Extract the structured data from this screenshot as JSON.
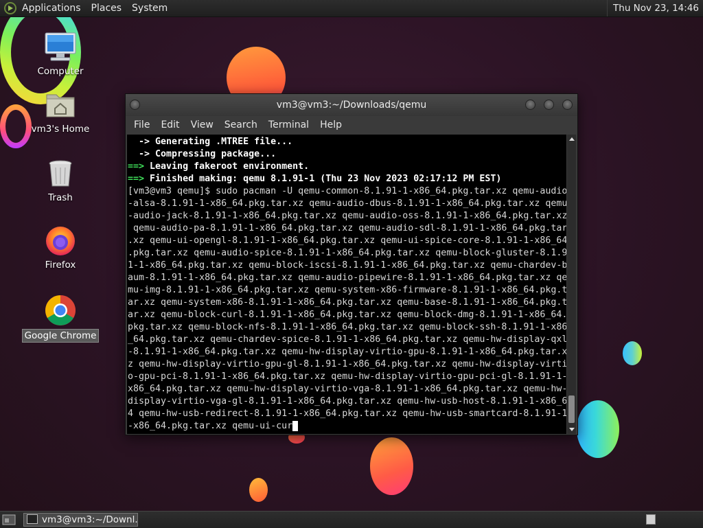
{
  "top_panel": {
    "menus": [
      "Applications",
      "Places",
      "System"
    ],
    "clock": "Thu Nov 23, 14:46"
  },
  "desktop": {
    "icons": [
      {
        "label": "Computer",
        "icon": "computer-icon"
      },
      {
        "label": "vm3's Home",
        "icon": "home-folder-icon"
      },
      {
        "label": "Trash",
        "icon": "trash-icon"
      },
      {
        "label": "Firefox",
        "icon": "firefox-icon"
      },
      {
        "label": "Google Chrome",
        "icon": "chrome-icon"
      }
    ]
  },
  "terminal": {
    "title": "vm3@vm3:~/Downloads/qemu",
    "menu": [
      "File",
      "Edit",
      "View",
      "Search",
      "Terminal",
      "Help"
    ],
    "lines": [
      {
        "prefix": "  -> ",
        "text": "Generating .MTREE file...",
        "style": "bold"
      },
      {
        "prefix": "  -> ",
        "text": "Compressing package...",
        "style": "bold"
      },
      {
        "prefix": "==> ",
        "text": "Leaving fakeroot environment.",
        "style": "bold"
      },
      {
        "prefix": "==> ",
        "text": "Finished making: qemu 8.1.91-1 (Thu 23 Nov 2023 02:17:12 PM EST)",
        "style": "bold"
      }
    ],
    "command_wrapped": [
      "[vm3@vm3 qemu]$ sudo pacman -U qemu-common-8.1.91-1-x86_64.pkg.tar.xz qemu-audio",
      "-alsa-8.1.91-1-x86_64.pkg.tar.xz qemu-audio-dbus-8.1.91-1-x86_64.pkg.tar.xz qemu",
      "-audio-jack-8.1.91-1-x86_64.pkg.tar.xz qemu-audio-oss-8.1.91-1-x86_64.pkg.tar.xz",
      " qemu-audio-pa-8.1.91-1-x86_64.pkg.tar.xz qemu-audio-sdl-8.1.91-1-x86_64.pkg.tar",
      ".xz qemu-ui-opengl-8.1.91-1-x86_64.pkg.tar.xz qemu-ui-spice-core-8.1.91-1-x86_64",
      ".pkg.tar.xz qemu-audio-spice-8.1.91-1-x86_64.pkg.tar.xz qemu-block-gluster-8.1.9",
      "1-1-x86_64.pkg.tar.xz qemu-block-iscsi-8.1.91-1-x86_64.pkg.tar.xz qemu-chardev-b",
      "aum-8.1.91-1-x86_64.pkg.tar.xz qemu-audio-pipewire-8.1.91-1-x86_64.pkg.tar.xz qe",
      "mu-img-8.1.91-1-x86_64.pkg.tar.xz qemu-system-x86-firmware-8.1.91-1-x86_64.pkg.t",
      "ar.xz qemu-system-x86-8.1.91-1-x86_64.pkg.tar.xz qemu-base-8.1.91-1-x86_64.pkg.t",
      "ar.xz qemu-block-curl-8.1.91-1-x86_64.pkg.tar.xz qemu-block-dmg-8.1.91-1-x86_64.",
      "pkg.tar.xz qemu-block-nfs-8.1.91-1-x86_64.pkg.tar.xz qemu-block-ssh-8.1.91-1-x86",
      "_64.pkg.tar.xz qemu-chardev-spice-8.1.91-1-x86_64.pkg.tar.xz qemu-hw-display-qxl",
      "-8.1.91-1-x86_64.pkg.tar.xz qemu-hw-display-virtio-gpu-8.1.91-1-x86_64.pkg.tar.x",
      "z qemu-hw-display-virtio-gpu-gl-8.1.91-1-x86_64.pkg.tar.xz qemu-hw-display-virti",
      "o-gpu-pci-8.1.91-1-x86_64.pkg.tar.xz qemu-hw-display-virtio-gpu-pci-gl-8.1.91-1-",
      "x86_64.pkg.tar.xz qemu-hw-display-virtio-vga-8.1.91-1-x86_64.pkg.tar.xz qemu-hw-",
      "display-virtio-vga-gl-8.1.91-1-x86_64.pkg.tar.xz qemu-hw-usb-host-8.1.91-1-x86_6",
      "4 qemu-hw-usb-redirect-8.1.91-1-x86_64.pkg.tar.xz qemu-hw-usb-smartcard-8.1.91-1",
      "-x86_64.pkg.tar.xz qemu-ui-cur"
    ]
  },
  "taskbar": {
    "task_label": "vm3@vm3:~/Downl..."
  },
  "colors": {
    "terminal_bg": "#000000",
    "prompt_arrow_green": "#3fe05a",
    "panel_bg": "#262626"
  }
}
